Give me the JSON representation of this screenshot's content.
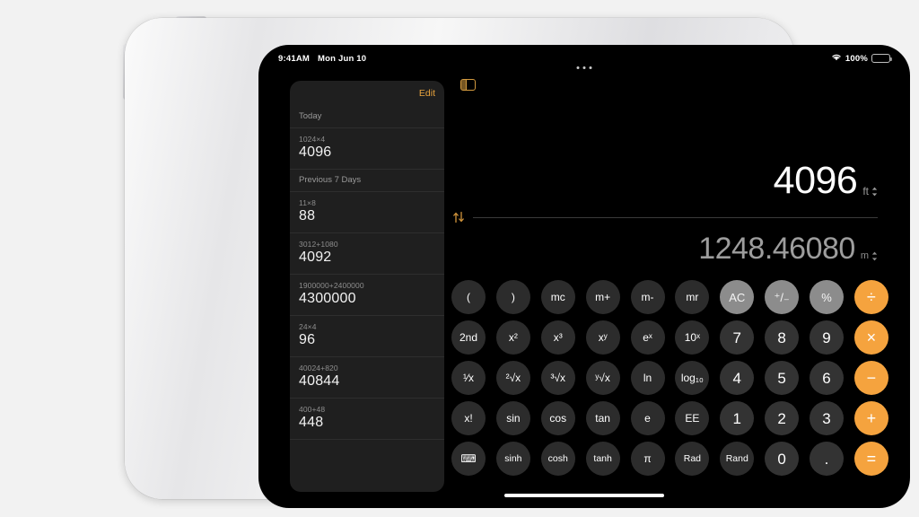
{
  "status_bar": {
    "time": "9:41AM",
    "date": "Mon Jun 10",
    "battery_percent": "100%",
    "wifi_icon": "wifi-icon",
    "battery_icon": "battery-icon"
  },
  "sidebar": {
    "edit_label": "Edit",
    "sections": [
      {
        "header": "Today",
        "entries": [
          {
            "expression": "1024×4",
            "result": "4096"
          }
        ]
      },
      {
        "header": "Previous 7 Days",
        "entries": [
          {
            "expression": "11×8",
            "result": "88"
          },
          {
            "expression": "3012+1080",
            "result": "4092"
          },
          {
            "expression": "1900000+2400000",
            "result": "4300000"
          },
          {
            "expression": "24×4",
            "result": "96"
          },
          {
            "expression": "40024+820",
            "result": "40844"
          },
          {
            "expression": "400+48",
            "result": "448"
          }
        ]
      }
    ]
  },
  "toolbar": {
    "sidebar_toggle_icon": "sidebar-toggle-icon"
  },
  "display": {
    "primary_value": "4096",
    "primary_unit": "ft",
    "secondary_value": "1248.46080",
    "secondary_unit": "m",
    "swap_icon": "swap-vertical-icon",
    "unit_chevron_icon": "chevron-up-down-icon"
  },
  "keypad": {
    "rows": [
      [
        {
          "label": "(",
          "name": "key-open-paren",
          "style": "fn"
        },
        {
          "label": ")",
          "name": "key-close-paren",
          "style": "fn"
        },
        {
          "label": "mc",
          "name": "key-memory-clear",
          "style": "fn"
        },
        {
          "label": "m+",
          "name": "key-memory-plus",
          "style": "fn"
        },
        {
          "label": "m-",
          "name": "key-memory-minus",
          "style": "fn"
        },
        {
          "label": "mr",
          "name": "key-memory-recall",
          "style": "fn"
        },
        {
          "label": "AC",
          "name": "key-all-clear",
          "style": "util"
        },
        {
          "label": "⁺/₋",
          "name": "key-sign-toggle",
          "style": "util"
        },
        {
          "label": "%",
          "name": "key-percent",
          "style": "util"
        },
        {
          "label": "÷",
          "name": "key-divide",
          "style": "op"
        }
      ],
      [
        {
          "label": "2nd",
          "name": "key-second-function",
          "style": "fn"
        },
        {
          "label": "x²",
          "name": "key-x-squared",
          "style": "fn"
        },
        {
          "label": "x³",
          "name": "key-x-cubed",
          "style": "fn"
        },
        {
          "label": "xʸ",
          "name": "key-x-power-y",
          "style": "fn"
        },
        {
          "label": "eˣ",
          "name": "key-e-power-x",
          "style": "fn"
        },
        {
          "label": "10ˣ",
          "name": "key-ten-power-x",
          "style": "fn"
        },
        {
          "label": "7",
          "name": "key-7",
          "style": "num"
        },
        {
          "label": "8",
          "name": "key-8",
          "style": "num"
        },
        {
          "label": "9",
          "name": "key-9",
          "style": "num"
        },
        {
          "label": "×",
          "name": "key-multiply",
          "style": "op"
        }
      ],
      [
        {
          "label": "¹⁄x",
          "name": "key-reciprocal",
          "style": "fn"
        },
        {
          "label": "²√x",
          "name": "key-square-root",
          "style": "fn"
        },
        {
          "label": "³√x",
          "name": "key-cube-root",
          "style": "fn"
        },
        {
          "label": "ʸ√x",
          "name": "key-nth-root",
          "style": "fn"
        },
        {
          "label": "ln",
          "name": "key-natural-log",
          "style": "fn"
        },
        {
          "label": "log₁₀",
          "name": "key-log-base-10",
          "style": "fn"
        },
        {
          "label": "4",
          "name": "key-4",
          "style": "num"
        },
        {
          "label": "5",
          "name": "key-5",
          "style": "num"
        },
        {
          "label": "6",
          "name": "key-6",
          "style": "num"
        },
        {
          "label": "−",
          "name": "key-subtract",
          "style": "op"
        }
      ],
      [
        {
          "label": "x!",
          "name": "key-factorial",
          "style": "fn"
        },
        {
          "label": "sin",
          "name": "key-sine",
          "style": "fn"
        },
        {
          "label": "cos",
          "name": "key-cosine",
          "style": "fn"
        },
        {
          "label": "tan",
          "name": "key-tangent",
          "style": "fn"
        },
        {
          "label": "e",
          "name": "key-euler-number",
          "style": "fn"
        },
        {
          "label": "EE",
          "name": "key-exponent-entry",
          "style": "fn"
        },
        {
          "label": "1",
          "name": "key-1",
          "style": "num"
        },
        {
          "label": "2",
          "name": "key-2",
          "style": "num"
        },
        {
          "label": "3",
          "name": "key-3",
          "style": "num"
        },
        {
          "label": "+",
          "name": "key-add",
          "style": "op"
        }
      ],
      [
        {
          "label": "⌨",
          "name": "key-mode-calculator-icon",
          "style": "fn"
        },
        {
          "label": "sinh",
          "name": "key-hyperbolic-sine",
          "style": "fn small"
        },
        {
          "label": "cosh",
          "name": "key-hyperbolic-cosine",
          "style": "fn small"
        },
        {
          "label": "tanh",
          "name": "key-hyperbolic-tangent",
          "style": "fn small"
        },
        {
          "label": "π",
          "name": "key-pi",
          "style": "fn"
        },
        {
          "label": "Rad",
          "name": "key-radians",
          "style": "fn small"
        },
        {
          "label": "Rand",
          "name": "key-random",
          "style": "fn small"
        },
        {
          "label": "0",
          "name": "key-0",
          "style": "num"
        },
        {
          "label": ".",
          "name": "key-decimal-point",
          "style": "num"
        },
        {
          "label": "=",
          "name": "key-equals",
          "style": "op"
        }
      ]
    ]
  },
  "colors": {
    "accent_orange": "#f5a33e",
    "util_gray": "#8c8c8c",
    "key_gray": "#333333",
    "sidebar_bg": "#1f1f1f",
    "screen_bg": "#000000",
    "page_bg": "#f2f2f2"
  },
  "home_indicator": "home-indicator"
}
